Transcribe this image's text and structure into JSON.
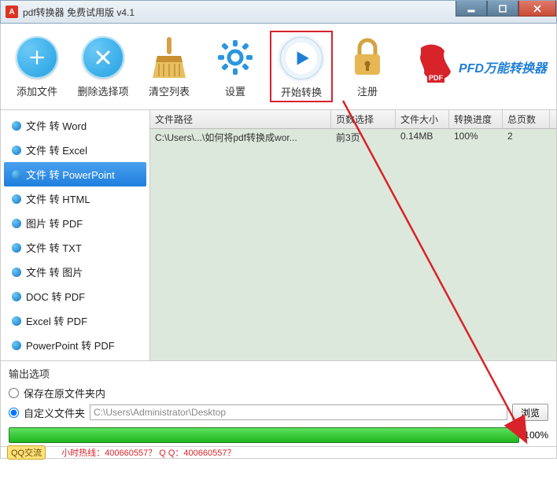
{
  "window": {
    "title": "pdf转换器 免费试用版 v4.1"
  },
  "toolbar": {
    "add": "添加文件",
    "remove": "删除选择项",
    "clear": "清空列表",
    "settings": "设置",
    "start": "开始转换",
    "register": "注册",
    "brand": "PFD万能转换器"
  },
  "sidebar": {
    "items": [
      {
        "label": "文件 转 Word"
      },
      {
        "label": "文件 转 Excel"
      },
      {
        "label": "文件 转 PowerPoint"
      },
      {
        "label": "文件 转 HTML"
      },
      {
        "label": "图片 转 PDF"
      },
      {
        "label": "文件 转 TXT"
      },
      {
        "label": "文件 转 图片"
      },
      {
        "label": "DOC 转 PDF"
      },
      {
        "label": "Excel 转 PDF"
      },
      {
        "label": "PowerPoint 转 PDF"
      }
    ],
    "selected_index": 2
  },
  "table": {
    "headers": {
      "path": "文件路径",
      "page": "页数选择",
      "size": "文件大小",
      "progress": "转换进度",
      "total": "总页数"
    },
    "rows": [
      {
        "path": "C:\\Users\\...\\如何将pdf转换成wor...",
        "page": "前3页",
        "size": "0.14MB",
        "progress": "100%",
        "total": "2"
      }
    ]
  },
  "output": {
    "section_title": "输出选项",
    "opt_original": "保存在原文件夹内",
    "opt_custom": "自定义文件夹",
    "path_value": "C:\\Users\\Administrator\\Desktop",
    "browse": "浏览",
    "progress_pct": "100%"
  },
  "footer": {
    "qq": "QQ交流",
    "hotline": "  小时热线：400660557？ Q Q：400660557？"
  }
}
